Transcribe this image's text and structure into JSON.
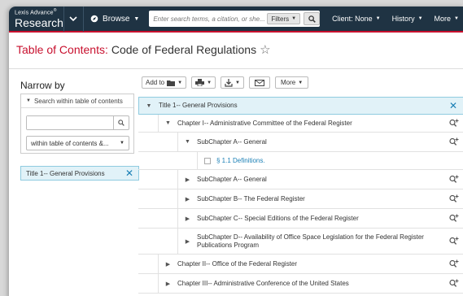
{
  "brand": {
    "top": "Lexis Advance",
    "reg": "®",
    "main": "Research"
  },
  "nav": {
    "browse": "Browse",
    "search_placeholder": "Enter search terms, a citation, or she...",
    "filters": "Filters",
    "client": "Client: None",
    "history": "History",
    "more": "More"
  },
  "page": {
    "title_prefix": "Table of Contents:",
    "title": "Code of Federal Regulations"
  },
  "narrow": {
    "heading": "Narrow by",
    "search_within": "Search within table of contents",
    "select_value": "within table of contents &...",
    "chip": "Title 1-- General Provisions"
  },
  "toolbar": {
    "add_to": "Add to",
    "more": "More"
  },
  "tree": [
    {
      "level": 0,
      "toggle": "down",
      "label": "Title 1-- General Provisions",
      "action": "close"
    },
    {
      "level": 1,
      "toggle": "down",
      "label": "Chapter I-- Administrative Committee of the Federal Register",
      "action": "search"
    },
    {
      "level": 2,
      "toggle": "down",
      "label": "SubChapter A-- General",
      "action": "search"
    },
    {
      "level": 3,
      "toggle": "checkbox",
      "label": "§ 1.1 Definitions.",
      "action": "none"
    },
    {
      "level": 2,
      "toggle": "right",
      "label": "SubChapter A-- General",
      "action": "search"
    },
    {
      "level": 2,
      "toggle": "right",
      "label": "SubChapter B-- The Federal Register",
      "action": "search"
    },
    {
      "level": 2,
      "toggle": "right",
      "label": "SubChapter C-- Special Editions of the Federal Register",
      "action": "search"
    },
    {
      "level": 2,
      "toggle": "right",
      "label": "SubChapter D-- Availability of Office Space Legislation for the Federal Register Publications Program",
      "action": "search"
    },
    {
      "level": 1,
      "toggle": "right",
      "label": "Chapter II-- Office of the Federal Register",
      "action": "search"
    },
    {
      "level": 1,
      "toggle": "right",
      "label": "Chapter III-- Administrative Conference of the United States",
      "action": "search"
    }
  ]
}
